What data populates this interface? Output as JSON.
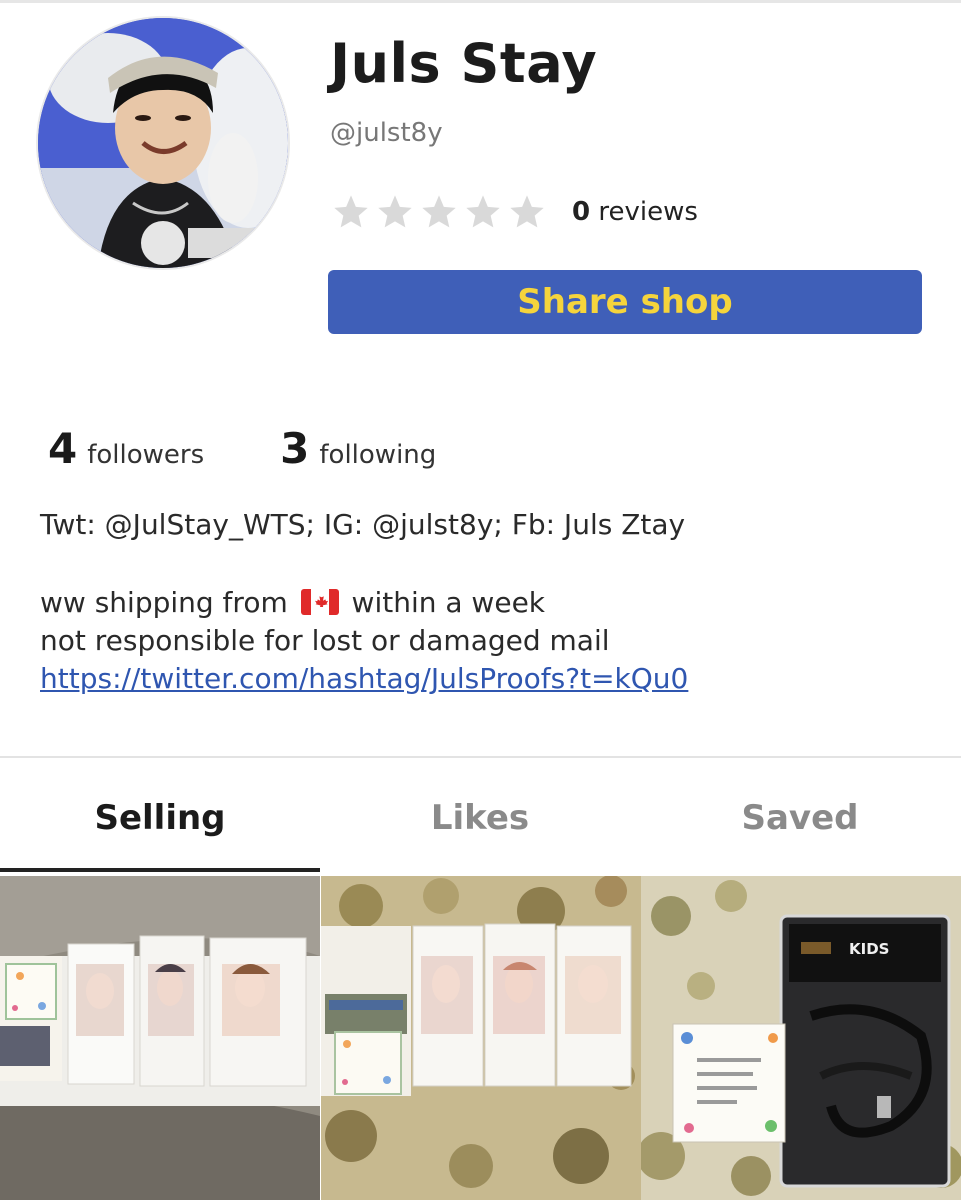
{
  "profile": {
    "name": "Juls Stay",
    "handle": "@julst8y",
    "rating_stars": 0,
    "reviews_count": "0",
    "reviews_label": "reviews",
    "share_label": "Share shop",
    "share_color": "#3f5fb8",
    "share_text_color": "#f5d43c"
  },
  "stats": {
    "followers_count": "4",
    "followers_label": "followers",
    "following_count": "3",
    "following_label": "following"
  },
  "bio": {
    "line1": "Twt: @JulStay_WTS; IG: @julst8y; Fb: Juls Ztay",
    "line2_pre": "ww shipping from",
    "line2_flag": "canada-flag-icon",
    "line2_post": "within a week",
    "line3": "not responsible for lost or damaged mail",
    "link": "https://twitter.com/hashtag/JulsProofs?t=kQu0"
  },
  "tabs": [
    {
      "label": "Selling",
      "active": true
    },
    {
      "label": "Likes",
      "active": false
    },
    {
      "label": "Saved",
      "active": false
    }
  ],
  "listings": [
    {
      "image": "photocard-folder-photo"
    },
    {
      "image": "photocard-folder-floral-photo"
    },
    {
      "image": "lanyard-package-photo",
      "package_label": "KIDS"
    }
  ]
}
